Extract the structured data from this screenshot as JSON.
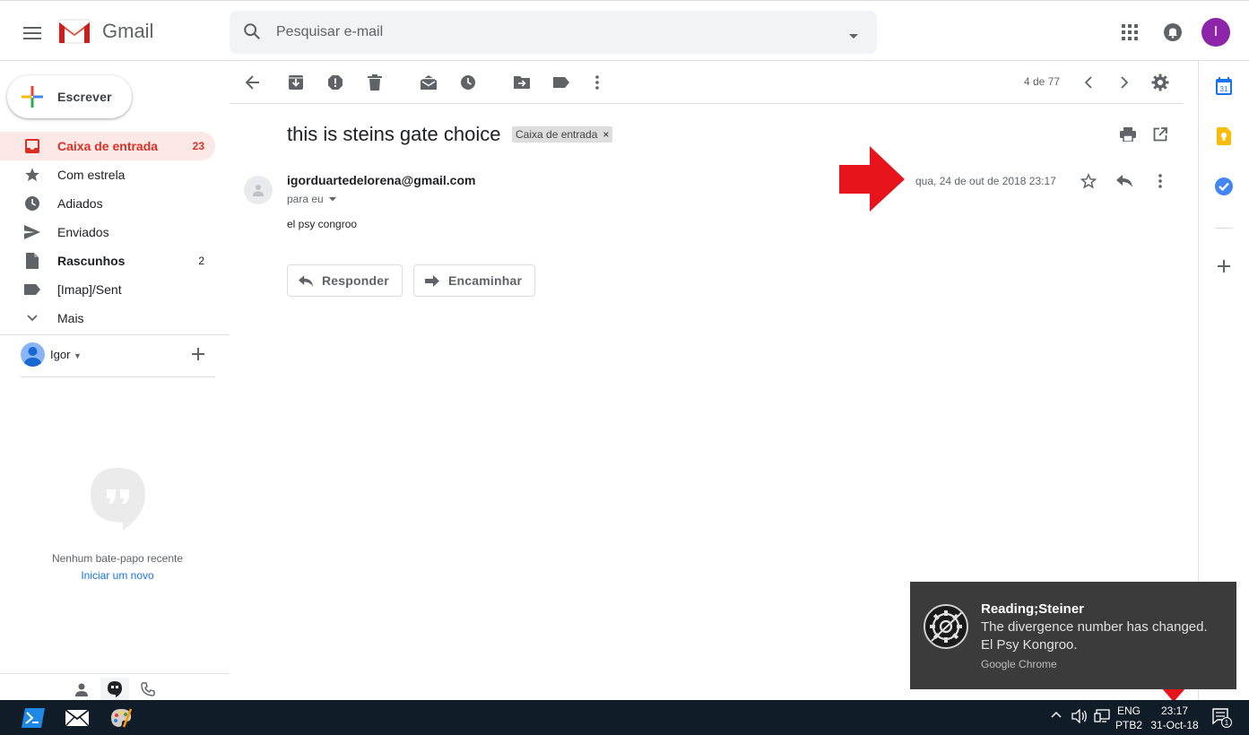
{
  "header": {
    "app_name": "Gmail",
    "search_placeholder": "Pesquisar e-mail",
    "avatar_letter": "I"
  },
  "sidebar": {
    "compose_label": "Escrever",
    "items": [
      {
        "label": "Caixa de entrada",
        "count": "23",
        "icon": "inbox-icon"
      },
      {
        "label": "Com estrela",
        "count": "",
        "icon": "star-icon"
      },
      {
        "label": "Adiados",
        "count": "",
        "icon": "clock-icon"
      },
      {
        "label": "Enviados",
        "count": "",
        "icon": "send-icon"
      },
      {
        "label": "Rascunhos",
        "count": "2",
        "icon": "draft-icon"
      },
      {
        "label": "[Imap]/Sent",
        "count": "",
        "icon": "label-icon"
      },
      {
        "label": "Mais",
        "count": "",
        "icon": "chevron-down-icon"
      }
    ],
    "account_name": "Igor",
    "chat_empty": "Nenhum bate-papo recente",
    "chat_start": "Iniciar um novo"
  },
  "toolbar": {
    "page_count": "4 de 77"
  },
  "message": {
    "subject": "this is steins gate choice",
    "label_chip": "Caixa de entrada",
    "label_close": "×",
    "sender": "igorduartedelorena@gmail.com",
    "to": "para eu",
    "date": "qua, 24 de out de 2018 23:17",
    "body": "el psy congroo",
    "reply_label": "Responder",
    "forward_label": "Encaminhar"
  },
  "side_panel": {
    "calendar_day": "31"
  },
  "notification": {
    "title": "Reading;Steiner",
    "line1": "The divergence number has changed.",
    "line2": "El Psy Kongroo.",
    "source": "Google Chrome"
  },
  "taskbar": {
    "lang_top": "ENG",
    "lang_bottom": "PTB2",
    "time": "23:17",
    "date": "31-Oct-18",
    "notif_count": "1"
  },
  "colors": {
    "accent_red": "#d93025",
    "arrow_red": "#e8141c",
    "avatar_purple": "#8e24aa",
    "taskbar_bg": "#101c28"
  }
}
